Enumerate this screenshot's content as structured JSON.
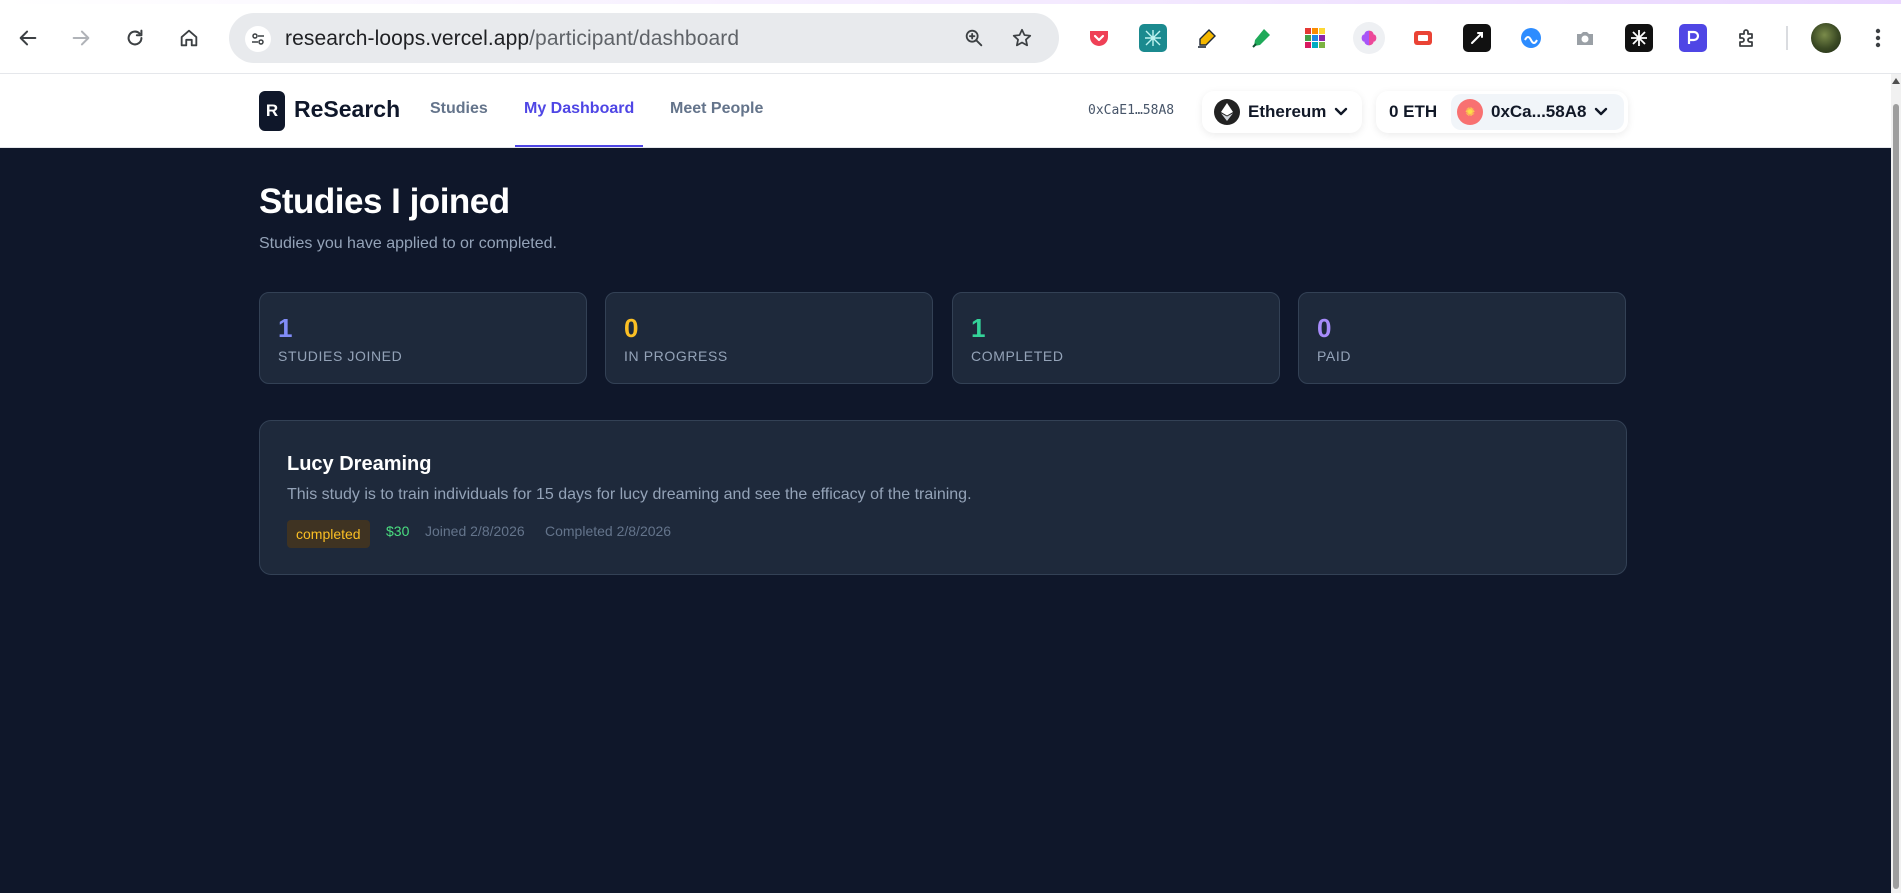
{
  "browser": {
    "url_domain": "research-loops.vercel.app",
    "url_path": "/participant/dashboard"
  },
  "header": {
    "logo_letter": "R",
    "logo_text": "ReSearch",
    "nav": [
      {
        "label": "Studies"
      },
      {
        "label": "My Dashboard",
        "active": true
      },
      {
        "label": "Meet People"
      }
    ],
    "address_short": "0xCaE1…58A8",
    "network_label": "Ethereum",
    "balance": "0 ETH",
    "account_label": "0xCa...58A8"
  },
  "main": {
    "title": "Studies I joined",
    "subtitle": "Studies you have applied to or completed."
  },
  "stats": [
    {
      "value": "1",
      "label": "STUDIES JOINED",
      "color": "#818cf8"
    },
    {
      "value": "0",
      "label": "IN PROGRESS",
      "color": "#fbbf24"
    },
    {
      "value": "1",
      "label": "COMPLETED",
      "color": "#34d399"
    },
    {
      "value": "0",
      "label": "PAID",
      "color": "#a78bfa"
    }
  ],
  "studies": [
    {
      "title": "Lucy Dreaming",
      "description": "This study is to train individuals for 15 days for lucy dreaming and see the efficacy of the training.",
      "status": "completed",
      "payment": "$30",
      "joined": "Joined 2/8/2026",
      "completed": "Completed 2/8/2026"
    }
  ]
}
